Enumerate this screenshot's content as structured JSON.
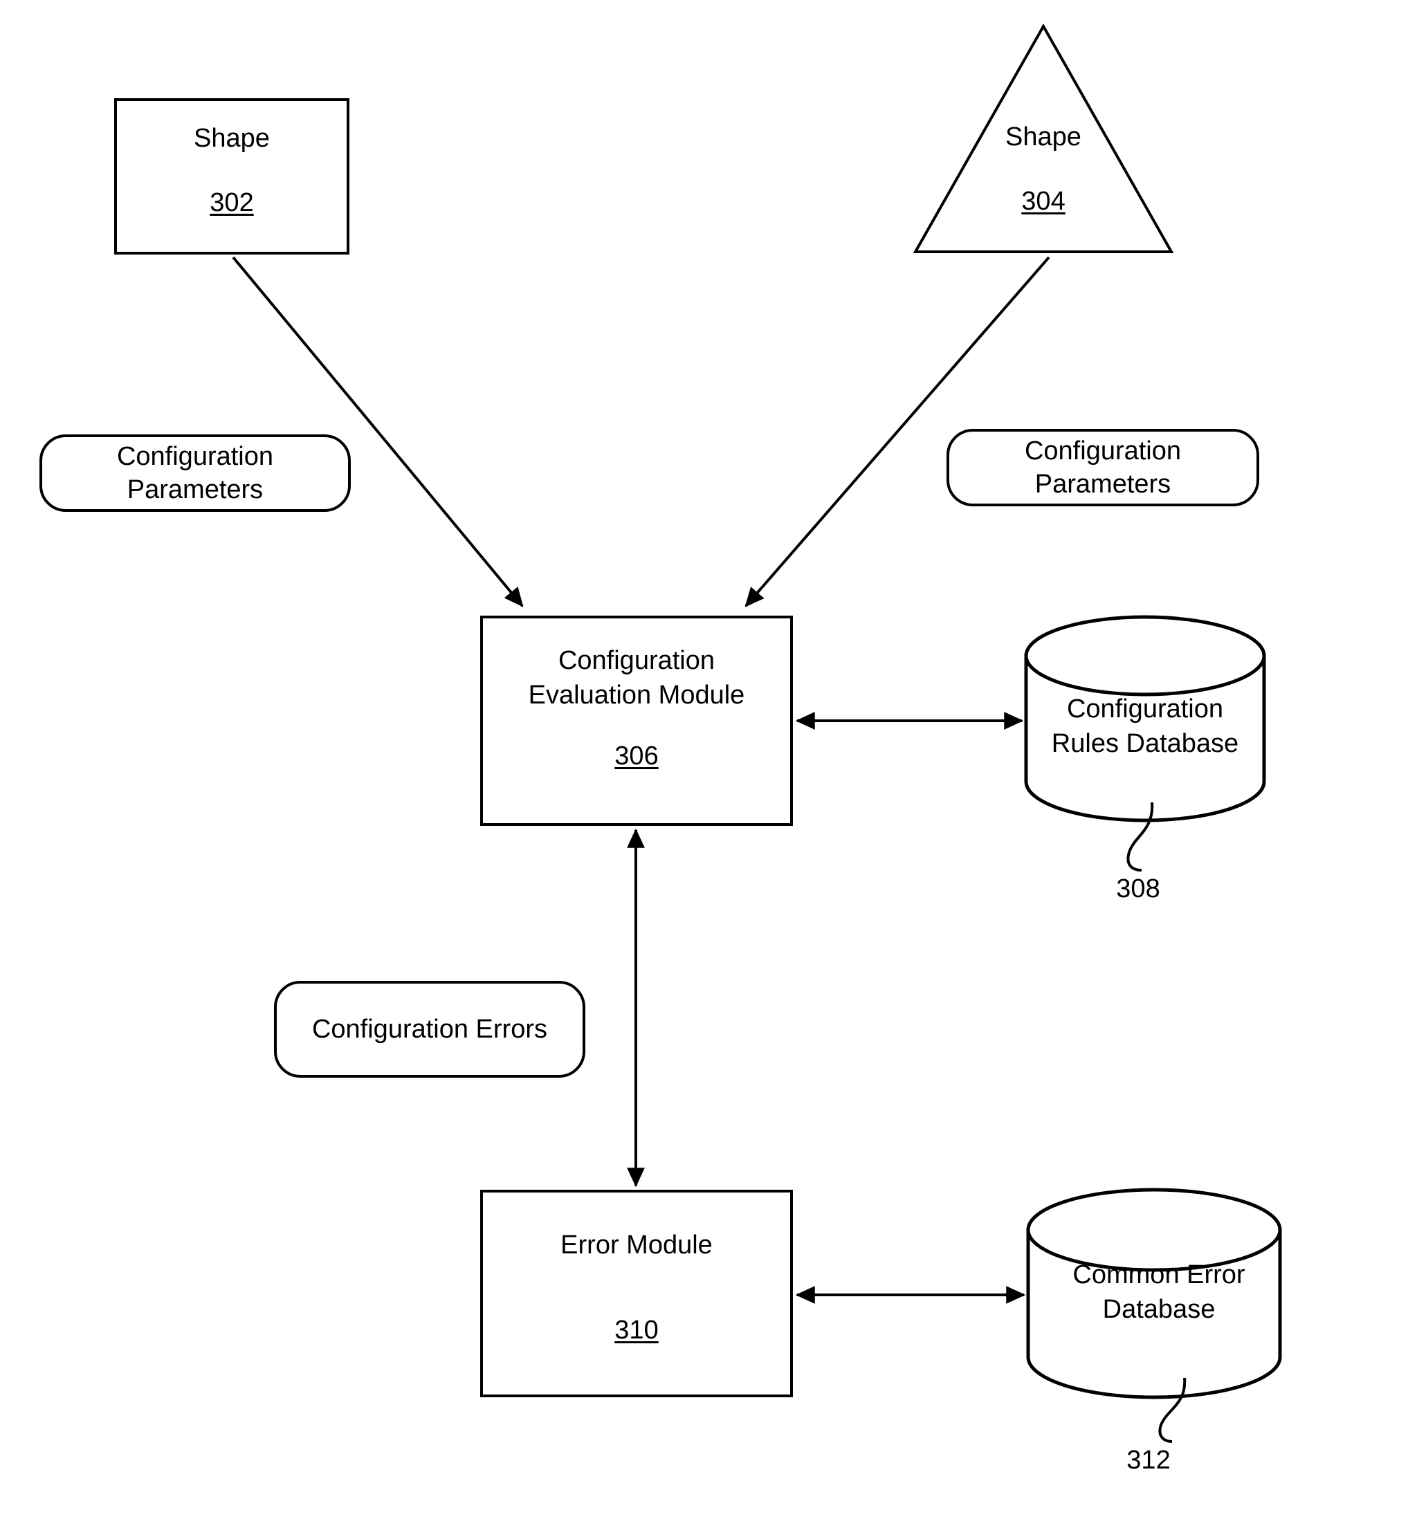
{
  "figure": {
    "type": "patent-block-diagram",
    "background_color": "#ffffff",
    "line_color": "#000000"
  },
  "nodes": {
    "shape_302": {
      "shape": "rectangle",
      "label": "Shape",
      "ref": "302"
    },
    "shape_304": {
      "shape": "triangle",
      "label": "Shape",
      "ref": "304"
    },
    "config_params_left": {
      "shape": "rounded-rectangle",
      "label": "Configuration\nParameters"
    },
    "config_params_right": {
      "shape": "rounded-rectangle",
      "label": "Configuration\nParameters"
    },
    "config_evaluation_module": {
      "shape": "rectangle",
      "label": "Configuration\nEvaluation Module",
      "ref": "306"
    },
    "config_rules_database": {
      "shape": "cylinder",
      "label": "Configuration\nRules Database",
      "ref": "308"
    },
    "config_errors": {
      "shape": "rounded-rectangle",
      "label": "Configuration Errors"
    },
    "error_module": {
      "shape": "rectangle",
      "label": "Error Module",
      "ref": "310"
    },
    "common_error_database": {
      "shape": "cylinder",
      "label": "Common Error\nDatabase",
      "ref": "312"
    }
  },
  "connectors": [
    {
      "name": "shape-302-to-module-306",
      "from": "shape_302",
      "to": "config_evaluation_module",
      "arrowheads": "end"
    },
    {
      "name": "shape-304-to-module-306",
      "from": "shape_304",
      "to": "config_evaluation_module",
      "arrowheads": "end"
    },
    {
      "name": "module-306-to-rules-database-308",
      "from": "config_evaluation_module",
      "to": "config_rules_database",
      "arrowheads": "both"
    },
    {
      "name": "module-306-to-error-module-310",
      "from": "config_evaluation_module",
      "to": "error_module",
      "arrowheads": "both"
    },
    {
      "name": "error-module-310-to-common-error-database-312",
      "from": "error_module",
      "to": "common_error_database",
      "arrowheads": "both"
    }
  ],
  "leader_lines": [
    {
      "name": "leader-308",
      "ref": "308",
      "target": "config_rules_database"
    },
    {
      "name": "leader-312",
      "ref": "312",
      "target": "common_error_database"
    }
  ]
}
